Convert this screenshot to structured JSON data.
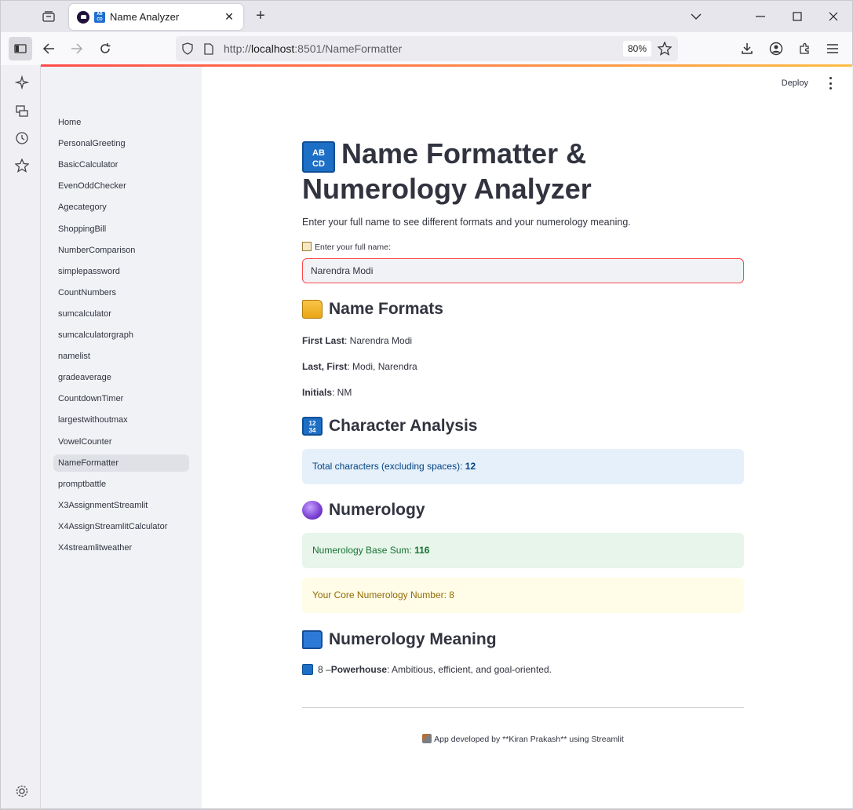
{
  "browser": {
    "tab_title": "Name Analyzer",
    "url_prefix": "http://",
    "url_host": "localhost",
    "url_path": ":8501/NameFormatter",
    "zoom": "80%"
  },
  "header": {
    "deploy_label": "Deploy"
  },
  "sidebar": {
    "items": [
      {
        "label": "Home"
      },
      {
        "label": "PersonalGreeting"
      },
      {
        "label": "BasicCalculator"
      },
      {
        "label": "EvenOddChecker"
      },
      {
        "label": "Agecategory"
      },
      {
        "label": "ShoppingBill"
      },
      {
        "label": "NumberComparison"
      },
      {
        "label": "simplepassword"
      },
      {
        "label": "CountNumbers"
      },
      {
        "label": "sumcalculator"
      },
      {
        "label": "sumcalculatorgraph"
      },
      {
        "label": "namelist"
      },
      {
        "label": "gradeaverage"
      },
      {
        "label": "CountdownTimer"
      },
      {
        "label": "largestwithoutmax"
      },
      {
        "label": "VowelCounter"
      },
      {
        "label": "NameFormatter"
      },
      {
        "label": "promptbattle"
      },
      {
        "label": "X3AssignmentStreamlit"
      },
      {
        "label": "X4AssignStreamlitCalculator"
      },
      {
        "label": "X4streamlitweather"
      }
    ],
    "active_index": 16
  },
  "main": {
    "title": "Name Formatter & Numerology Analyzer",
    "title_icon_text": [
      "AB",
      "CD"
    ],
    "intro": "Enter your full name to see different formats and your numerology meaning.",
    "input_label": "Enter your full name:",
    "input_value": "Narendra Modi",
    "sections": {
      "formats_heading": "Name Formats",
      "character_heading": "Character Analysis",
      "numerology_heading": "Numerology",
      "meaning_heading": "Numerology Meaning"
    },
    "formats": {
      "first_last_label": "First Last",
      "first_last_value": ": Narendra Modi",
      "last_first_label": "Last, First",
      "last_first_value": ": Modi, Narendra",
      "initials_label": "Initials",
      "initials_value": ": NM"
    },
    "character_info": {
      "text": "Total characters (excluding spaces): ",
      "value": "12"
    },
    "numerology": {
      "base_text": "Numerology Base Sum: ",
      "base_value": "116",
      "core_text": "Your Core Numerology Number: 8"
    },
    "meaning": {
      "prefix": "8 – ",
      "title": "Powerhouse",
      "text": ": Ambitious, efficient, and goal-oriented."
    },
    "footer": "App developed by **Kiran Prakash** using Streamlit"
  }
}
